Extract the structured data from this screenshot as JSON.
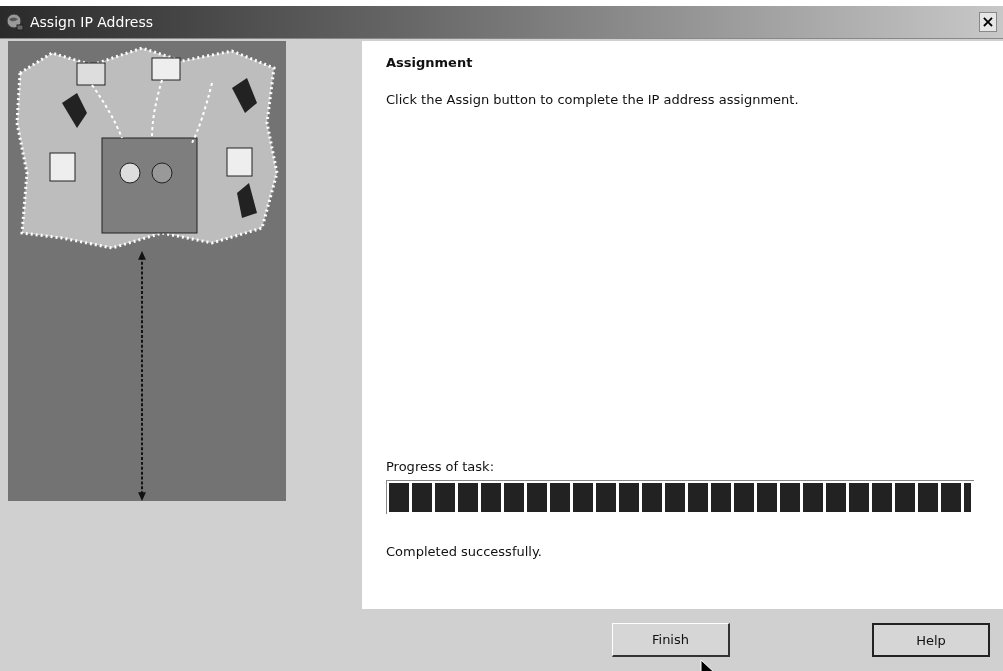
{
  "window": {
    "title": "Assign IP Address",
    "close": "×"
  },
  "page": {
    "heading": "Assignment",
    "instruction": "Click the Assign button to complete the IP address assignment."
  },
  "progress": {
    "label": "Progress of task:",
    "level": 1
  },
  "status": "Completed successfully.",
  "buttons": [
    {
      "label": "Finish",
      "hovered": true
    },
    {
      "label": "Help",
      "hovered": false
    }
  ]
}
